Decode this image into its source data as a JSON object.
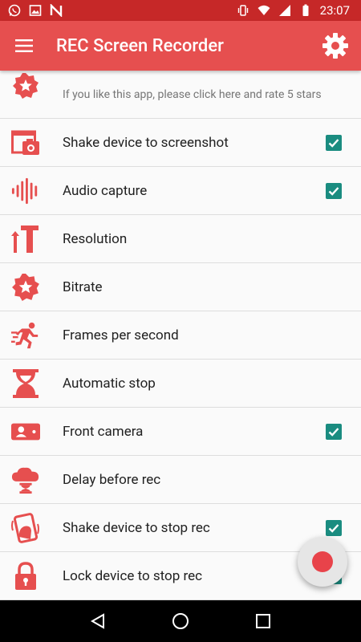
{
  "status_bar": {
    "time": "23:07",
    "left_icons": [
      "whatsapp-icon",
      "image-icon",
      "n-app-icon"
    ],
    "right_icons": [
      "vibrate-icon",
      "wifi-icon",
      "signal-icon",
      "battery-icon"
    ]
  },
  "app_bar": {
    "title": "REC Screen Recorder",
    "color": "#e64f4f"
  },
  "settings": [
    {
      "label": "If you like this app, please click here and rate 5 stars",
      "icon": "star-badge-icon",
      "checked": null,
      "subtle": true
    },
    {
      "label": "Shake device to screenshot",
      "icon": "screenshot-camera-icon",
      "checked": true
    },
    {
      "label": "Audio capture",
      "icon": "audio-waveform-icon",
      "checked": true
    },
    {
      "label": "Resolution",
      "icon": "resolution-icon",
      "checked": null
    },
    {
      "label": "Bitrate",
      "icon": "bitrate-badge-icon",
      "checked": null
    },
    {
      "label": "Frames per second",
      "icon": "running-figure-icon",
      "checked": null
    },
    {
      "label": "Automatic stop",
      "icon": "hourglass-icon",
      "checked": null
    },
    {
      "label": "Front camera",
      "icon": "front-camera-icon",
      "checked": true
    },
    {
      "label": "Delay before rec",
      "icon": "delay-cloud-icon",
      "checked": null
    },
    {
      "label": "Shake device to stop rec",
      "icon": "shake-phone-icon",
      "checked": true
    },
    {
      "label": "Lock device to stop rec",
      "icon": "lock-icon",
      "checked": true
    }
  ],
  "accent_colors": {
    "icon_red": "#e64f4f",
    "checkbox_teal": "#1a8c80",
    "record_red": "#e8434a"
  },
  "nav_bar": {
    "buttons": [
      "back-icon",
      "home-icon",
      "recents-icon"
    ]
  }
}
